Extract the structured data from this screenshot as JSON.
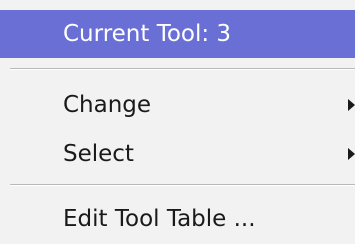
{
  "menu": {
    "header": "Current Tool: 3",
    "items": [
      {
        "label": "Change",
        "submenu": true
      },
      {
        "label": "Select",
        "submenu": true
      },
      {
        "label": "Edit Tool Table ...",
        "submenu": false
      }
    ],
    "submenu_icon": "triangle-right-icon"
  },
  "colors": {
    "header_background": "#6a6fd6",
    "menu_background": "#f2f2f2",
    "text": "#1a1a1a"
  }
}
